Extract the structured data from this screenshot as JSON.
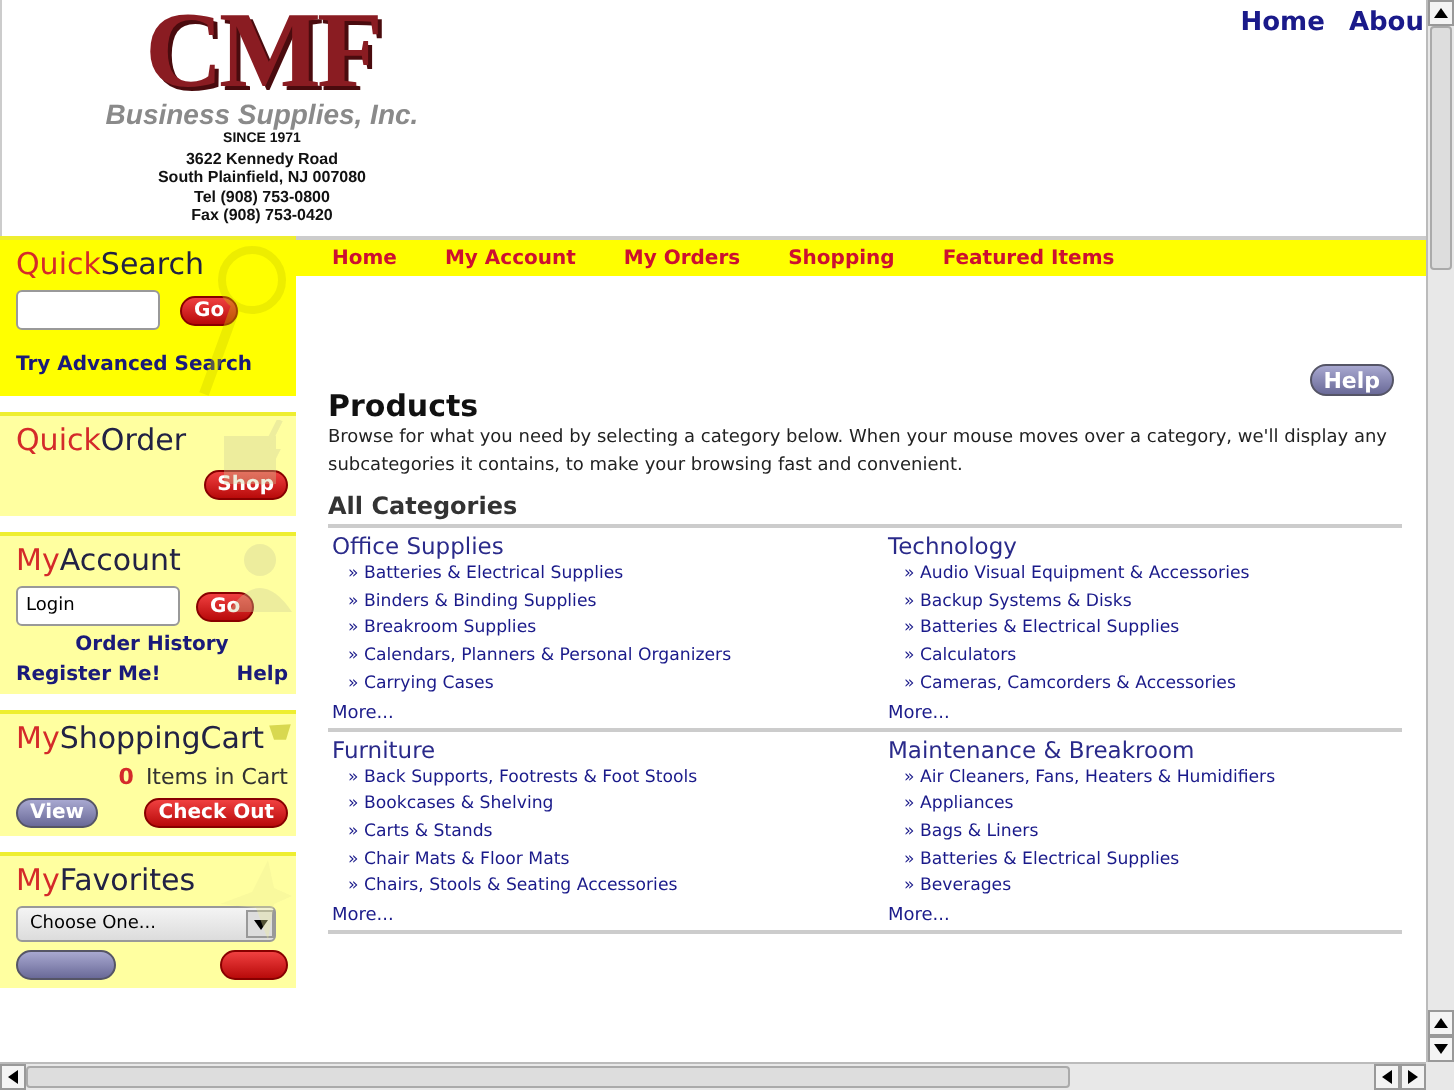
{
  "logo": {
    "mark": "CMF",
    "name": "Business Supplies, Inc.",
    "since": "SINCE 1971",
    "address": [
      "3622 Kennedy Road",
      "South Plainfield, NJ 007080",
      "Tel (908) 753-0800",
      "Fax (908) 753-0420"
    ]
  },
  "top_links": [
    "Home",
    "Abou"
  ],
  "nav": [
    "Home",
    "My Account",
    "My Orders",
    "Shopping",
    "Featured Items"
  ],
  "sidebar": {
    "quick_search": {
      "title_a": "Quick",
      "title_b": "Search",
      "button": "Go",
      "link": "Try Advanced Search"
    },
    "quick_order": {
      "title_a": "Quick",
      "title_b": "Order",
      "button": "Shop"
    },
    "my_account": {
      "title_a": "My",
      "title_b": "Account",
      "login_placeholder": "Login",
      "button": "Go",
      "history": "Order History",
      "register": "Register Me!",
      "help": "Help"
    },
    "cart": {
      "title_a": "My",
      "title_b": "ShoppingCart",
      "count": "0",
      "count_label": "Items in Cart",
      "view": "View",
      "checkout": "Check Out"
    },
    "favorites": {
      "title_a": "My",
      "title_b": "Favorites",
      "select": "Choose One..."
    }
  },
  "main": {
    "help": "Help",
    "title": "Products",
    "intro": "Browse for what you need by selecting a category below. When your mouse moves over a category, we'll display any subcategories it contains, to make your browsing fast and convenient.",
    "heading": "All Categories",
    "categories": [
      {
        "name": "Office Supplies",
        "items": [
          "Batteries & Electrical Supplies",
          "Binders & Binding Supplies",
          "Breakroom Supplies",
          "Calendars, Planners & Personal Organizers",
          "Carrying Cases"
        ],
        "more": "More..."
      },
      {
        "name": "Technology",
        "items": [
          "Audio Visual Equipment & Accessories",
          "Backup Systems & Disks",
          "Batteries & Electrical Supplies",
          "Calculators",
          "Cameras, Camcorders & Accessories"
        ],
        "more": "More..."
      },
      {
        "name": "Furniture",
        "items": [
          "Back Supports, Footrests & Foot Stools",
          "Bookcases & Shelving",
          "Carts & Stands",
          "Chair Mats & Floor Mats",
          "Chairs, Stools & Seating Accessories"
        ],
        "more": "More..."
      },
      {
        "name": "Maintenance & Breakroom",
        "items": [
          "Air Cleaners, Fans, Heaters & Humidifiers",
          "Appliances",
          "Bags & Liners",
          "Batteries & Electrical Supplies",
          "Beverages"
        ],
        "more": "More..."
      }
    ]
  },
  "bullet": "»"
}
